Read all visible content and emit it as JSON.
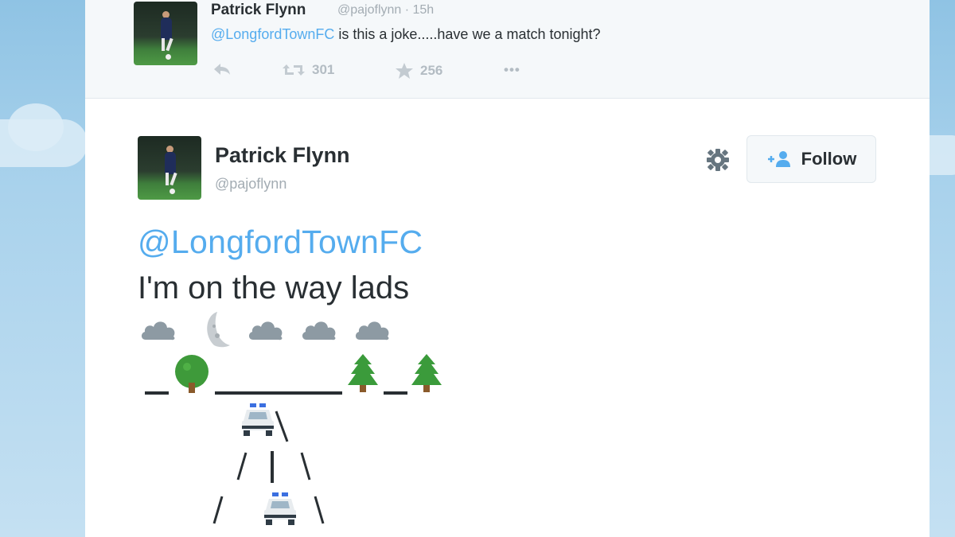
{
  "colors": {
    "accent": "#55acee",
    "text": "#292f33",
    "muted": "#a3acb3",
    "tree": "#3b9b3b"
  },
  "previous_tweet": {
    "name": "Patrick Flynn",
    "handle": "@pajoflynn · 15h",
    "mention": "@LongfordTownFC",
    "text": " is this a joke.....have we a match tonight?",
    "retweets": "301",
    "favorites": "256",
    "more": "•••"
  },
  "tweet": {
    "name": "Patrick Flynn",
    "handle": "@pajoflynn",
    "follow_label": "Follow",
    "mention": "@LongfordTownFC",
    "line": "I'm on the way lads",
    "icons": [
      "reply-icon",
      "retweet-icon",
      "star-icon",
      "gear-icon",
      "add-user-icon",
      "cloud-emoji",
      "moon-emoji",
      "tree-emoji",
      "evergreen-emoji",
      "police-car-emoji"
    ]
  }
}
